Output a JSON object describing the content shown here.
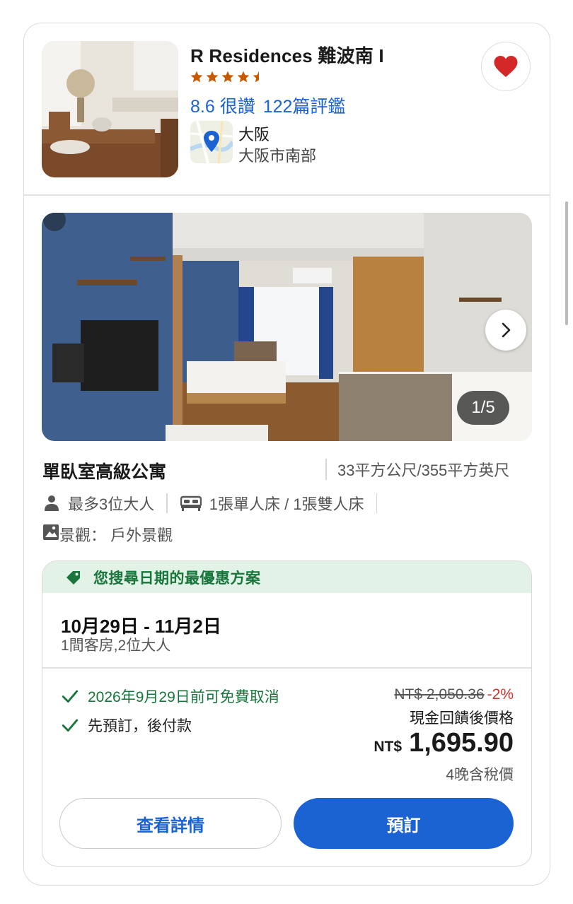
{
  "colors": {
    "accent": "#1b63d2",
    "green": "#18753c",
    "discount_red": "#d9302a",
    "star": "#c75a00"
  },
  "hotel": {
    "name": "R Residences 難波南 I",
    "stars": 4.5,
    "score": "8.6",
    "score_label": "很讚",
    "review_count": "122篇評鑑",
    "city": "大阪",
    "district": "大阪市南部",
    "favorite_icon": "heart-icon"
  },
  "gallery": {
    "counter": "1/5",
    "next_icon": "chevron-right-icon"
  },
  "room": {
    "title": "單臥室高級公寓",
    "size": "33平方公尺/355平方英尺",
    "max_guests": "最多3位大人",
    "beds": "1張單人床 / 1張雙人床",
    "view": "景觀： 戶外景觀"
  },
  "offer": {
    "badge": "您搜尋日期的最優惠方案",
    "dates": "10月29日 - 11月2日",
    "occupancy": "1間客房,2位大人",
    "perks": [
      "2026年9月29日前可免費取消",
      "先預訂，後付款"
    ],
    "original_price": "NT$ 2,050.36",
    "discount": "-2%",
    "price_label": "現金回饋後價格",
    "currency": "NT$",
    "price": "1,695.90",
    "tax_note": "4晚含稅價",
    "details_button": "查看詳情",
    "book_button": "預訂"
  }
}
